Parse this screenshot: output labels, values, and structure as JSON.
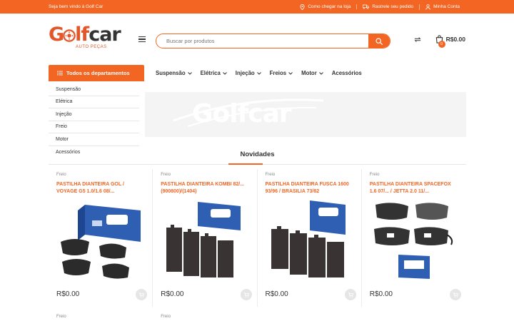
{
  "topbar": {
    "welcome": "Seja bem vindo à Golf Car",
    "links": [
      "Como chegar na loja",
      "Rastrele seu pedido",
      "Minha Conta"
    ]
  },
  "logo": {
    "part1": "G",
    "part2": "lf",
    "part3": "car",
    "sub": "AUTO PEÇAS"
  },
  "search": {
    "placeholder": "Buscar por produtos"
  },
  "cart": {
    "count": "0",
    "total": "R$0.00"
  },
  "departments": {
    "label": "Todos os departamentos"
  },
  "mainnav": [
    "Suspensão",
    "Elétrica",
    "Injeção",
    "Freios",
    "Motor",
    "Acessórios"
  ],
  "sidebar": [
    "Suspensão",
    "Elétrica",
    "Injeção",
    "Freio",
    "Motor",
    "Acessórios"
  ],
  "banner": {
    "watermark": "Golfcar"
  },
  "section": {
    "title": "Novidades"
  },
  "products": [
    {
      "category": "Freio",
      "title": "PASTILHA DIANTEIRA GOL / VOYAGE G5 1.0/1.6 08/...",
      "price": "R$0.00"
    },
    {
      "category": "Freio",
      "title": "PASTILHA DIANTEIRA KOMBI 82/... (900800)/(1404)",
      "price": "R$0.00"
    },
    {
      "category": "Freio",
      "title": "PASTILHA DIANTEIRA FUSCA 1600 93/96 / BRASILIA 73/82",
      "price": "R$0.00"
    },
    {
      "category": "Freio",
      "title": "PASTILHA DIANTEIRA SPACEFOX 1.6 07/... / JETTA 2.0 11/...",
      "price": "R$0.00"
    }
  ],
  "row2": [
    "Freio",
    "Freio"
  ],
  "colors": {
    "accent": "#f26522",
    "text": "#333333"
  }
}
